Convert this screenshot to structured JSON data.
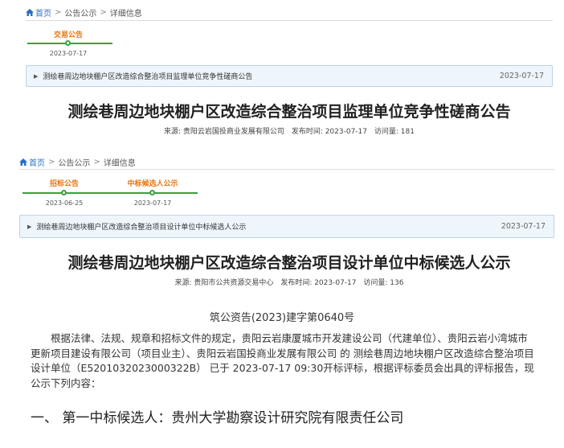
{
  "notice1": {
    "breadcrumb": [
      "首页",
      "公告公示",
      "详细信息"
    ],
    "timeline": [
      {
        "label": "交易公告",
        "date": "2023-07-17"
      }
    ],
    "item": {
      "text": "测绘巷周边地块棚户区改造综合整治项目监理单位竞争性磋商公告",
      "date": "2023-07-17"
    },
    "title": "测绘巷周边地块棚户区改造综合整治项目监理单位竞争性磋商公告",
    "meta": {
      "source": "来源: 贵阳云岩国投商业发展有限公司",
      "publish": "发布时间: 2023-07-17",
      "views": "访问量: 181"
    }
  },
  "notice2": {
    "breadcrumb": [
      "首页",
      "公告公示",
      "详细信息"
    ],
    "timeline": [
      {
        "label": "招标公告",
        "date": "2023-06-25"
      },
      {
        "label": "中标候选人公示",
        "date": "2023-07-17"
      }
    ],
    "item": {
      "text": "测绘巷周边地块棚户区改造综合整治项目设计单位中标候选人公示",
      "date": "2023-07-17"
    },
    "title": "测绘巷周边地块棚户区改造综合整治项目设计单位中标候选人公示",
    "meta": {
      "source": "来源: 贵阳市公共资源交易中心",
      "publish": "发布时间: 2023-07-17",
      "views": "访问量: 136"
    },
    "doc_number": "筑公资告(2023)建字第0640号",
    "body": "根据法律、法规、规章和招标文件的规定，贵阳云岩康厦城市开发建设公司（代建单位）、贵阳云岩小湾城市更新项目建设有限公司（项目业主）、贵阳云岩国投商业发展有限公司 的 测绘巷周边地块棚户区改造综合整治项目设计单位（E5201032023000322B） 已于 2023-07-17 09:30开标评标，根据评标委员会出具的评标报告，现公示下列内容：",
    "section_heading": "一、   第一中标候选人：贵州大学勘察设计研究院有限责任公司"
  },
  "colors": {
    "accent_orange": "#e8730e",
    "timeline_green": "#38a23c",
    "link_blue": "#2b6fc2",
    "bar_bg": "#eef5fb"
  },
  "icons": {
    "home": "home-icon",
    "separator": "chevron-right-icon",
    "item_marker": "triangle-right-icon"
  }
}
